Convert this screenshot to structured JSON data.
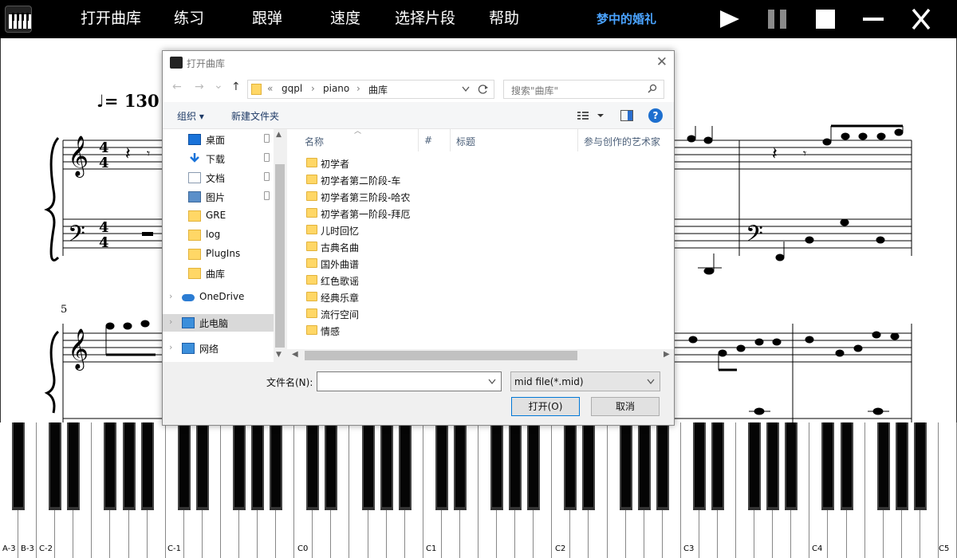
{
  "topbar": {
    "menu": [
      {
        "id": "open-library",
        "label": "打开曲库"
      },
      {
        "id": "practice",
        "label": "练习"
      },
      {
        "id": "follow",
        "label": "跟弹"
      },
      {
        "id": "speed",
        "label": "速度"
      },
      {
        "id": "select-segment",
        "label": "选择片段"
      },
      {
        "id": "help",
        "label": "帮助"
      }
    ],
    "song_title": "梦中的婚礼",
    "controls": [
      "play-icon",
      "pause-icon",
      "stop-icon",
      "minimize-icon",
      "close-icon"
    ]
  },
  "score": {
    "tempo_note": "♩",
    "tempo_text": "= 130",
    "measure_number": "5"
  },
  "dialog": {
    "title": "打开曲库",
    "close": "✕",
    "nav": {
      "back": "←",
      "forward": "→",
      "down": "⌄",
      "up": "↑"
    },
    "address": {
      "prefix": "«",
      "segments": [
        "gqpl",
        "piano",
        "曲库"
      ],
      "separator": "›"
    },
    "search_placeholder": "搜索\"曲库\"",
    "toolbar": {
      "organize": "组织 ▾",
      "new_folder": "新建文件夹",
      "help": "?"
    },
    "nav_pane": {
      "quick_access": [
        {
          "label": "桌面",
          "icon": "desktop-icon",
          "pinned": true
        },
        {
          "label": "下载",
          "icon": "download-icon",
          "pinned": true
        },
        {
          "label": "文档",
          "icon": "document-icon",
          "pinned": true
        },
        {
          "label": "图片",
          "icon": "pictures-icon",
          "pinned": true
        },
        {
          "label": "GRE",
          "icon": "folder-icon",
          "pinned": false
        },
        {
          "label": "log",
          "icon": "folder-icon",
          "pinned": false
        },
        {
          "label": "PlugIns",
          "icon": "folder-icon",
          "pinned": false
        },
        {
          "label": "曲库",
          "icon": "folder-icon",
          "pinned": false
        }
      ],
      "roots": [
        {
          "label": "OneDrive",
          "icon": "onedrive-icon"
        },
        {
          "label": "此电脑",
          "icon": "computer-icon",
          "selected": true
        },
        {
          "label": "网络",
          "icon": "network-icon"
        }
      ]
    },
    "columns": [
      "名称",
      "#",
      "标题",
      "参与创作的艺术家"
    ],
    "files": [
      "初学者",
      "初学者第二阶段-车",
      "初学者第三阶段-哈农",
      "初学者第一阶段-拜厄",
      "儿时回忆",
      "古典名曲",
      "国外曲谱",
      "红色歌谣",
      "经典乐章",
      "流行空间",
      "情感"
    ],
    "filename_label": "文件名(N):",
    "filename_value": "",
    "filter_value": "mid file(*.mid)",
    "open_label": "打开(O)",
    "cancel_label": "取消"
  },
  "piano": {
    "labels": [
      "A-3",
      "B-3",
      "C-2",
      "C-1",
      "C0",
      "C1",
      "C2",
      "C3",
      "C4",
      "C5"
    ]
  },
  "colors": {
    "topbar_bg": "#000000",
    "accent": "#4aa3ff",
    "dialog_bg": "#f0f0f0",
    "folder": "#ffd766"
  }
}
